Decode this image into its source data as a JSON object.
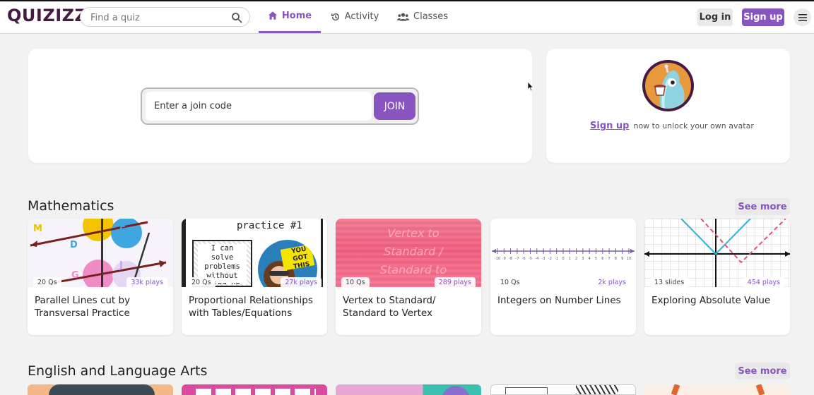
{
  "header": {
    "logo": "QUIZIZZ",
    "search_placeholder": "Find a quiz",
    "nav": [
      {
        "label": "Home",
        "active": true
      },
      {
        "label": "Activity",
        "active": false
      },
      {
        "label": "Classes",
        "active": false
      }
    ],
    "login_label": "Log in",
    "signup_label": "Sign up"
  },
  "join": {
    "placeholder": "Enter a join code",
    "button_label": "JOIN"
  },
  "avatar_panel": {
    "signup_link": "Sign up",
    "unlock_text": "now to unlock your own avatar"
  },
  "sections": [
    {
      "title": "Mathematics",
      "see_more": "See more",
      "cards": [
        {
          "title": "Parallel Lines cut by Transversal Practice",
          "count": "20 Qs",
          "plays": "33k plays"
        },
        {
          "title": "Proportional Relationships with Tables/Equations",
          "count": "20 Qs",
          "plays": "27k plays",
          "thumb_heading": "practice #1",
          "thumb_note": "I can solve problems without giving up.",
          "thumb_sticker": "YOU GOT THIS"
        },
        {
          "title": "Vertex to Standard/ Standard to Vertex",
          "count": "10 Qs",
          "plays": "289 plays",
          "thumb_text": "Vertex to Standard / Standard to"
        },
        {
          "title": "Integers on Number Lines",
          "count": "10 Qs",
          "plays": "2k plays",
          "axis_labels": [
            "-10",
            "-9",
            "-8",
            "-7",
            "-6",
            "-5",
            "-4",
            "-3",
            "-2",
            "-1",
            "0",
            "1",
            "2",
            "3",
            "4",
            "5",
            "6",
            "7",
            "8",
            "9",
            "10"
          ]
        },
        {
          "title": "Exploring Absolute Value",
          "count": "13 slides",
          "plays": "454 plays"
        }
      ]
    },
    {
      "title": "English and Language Arts",
      "see_more": "See more"
    }
  ],
  "colors": {
    "brand_purple": "#8854c0",
    "logo_dark": "#461a42",
    "background": "#f2f2f2"
  }
}
